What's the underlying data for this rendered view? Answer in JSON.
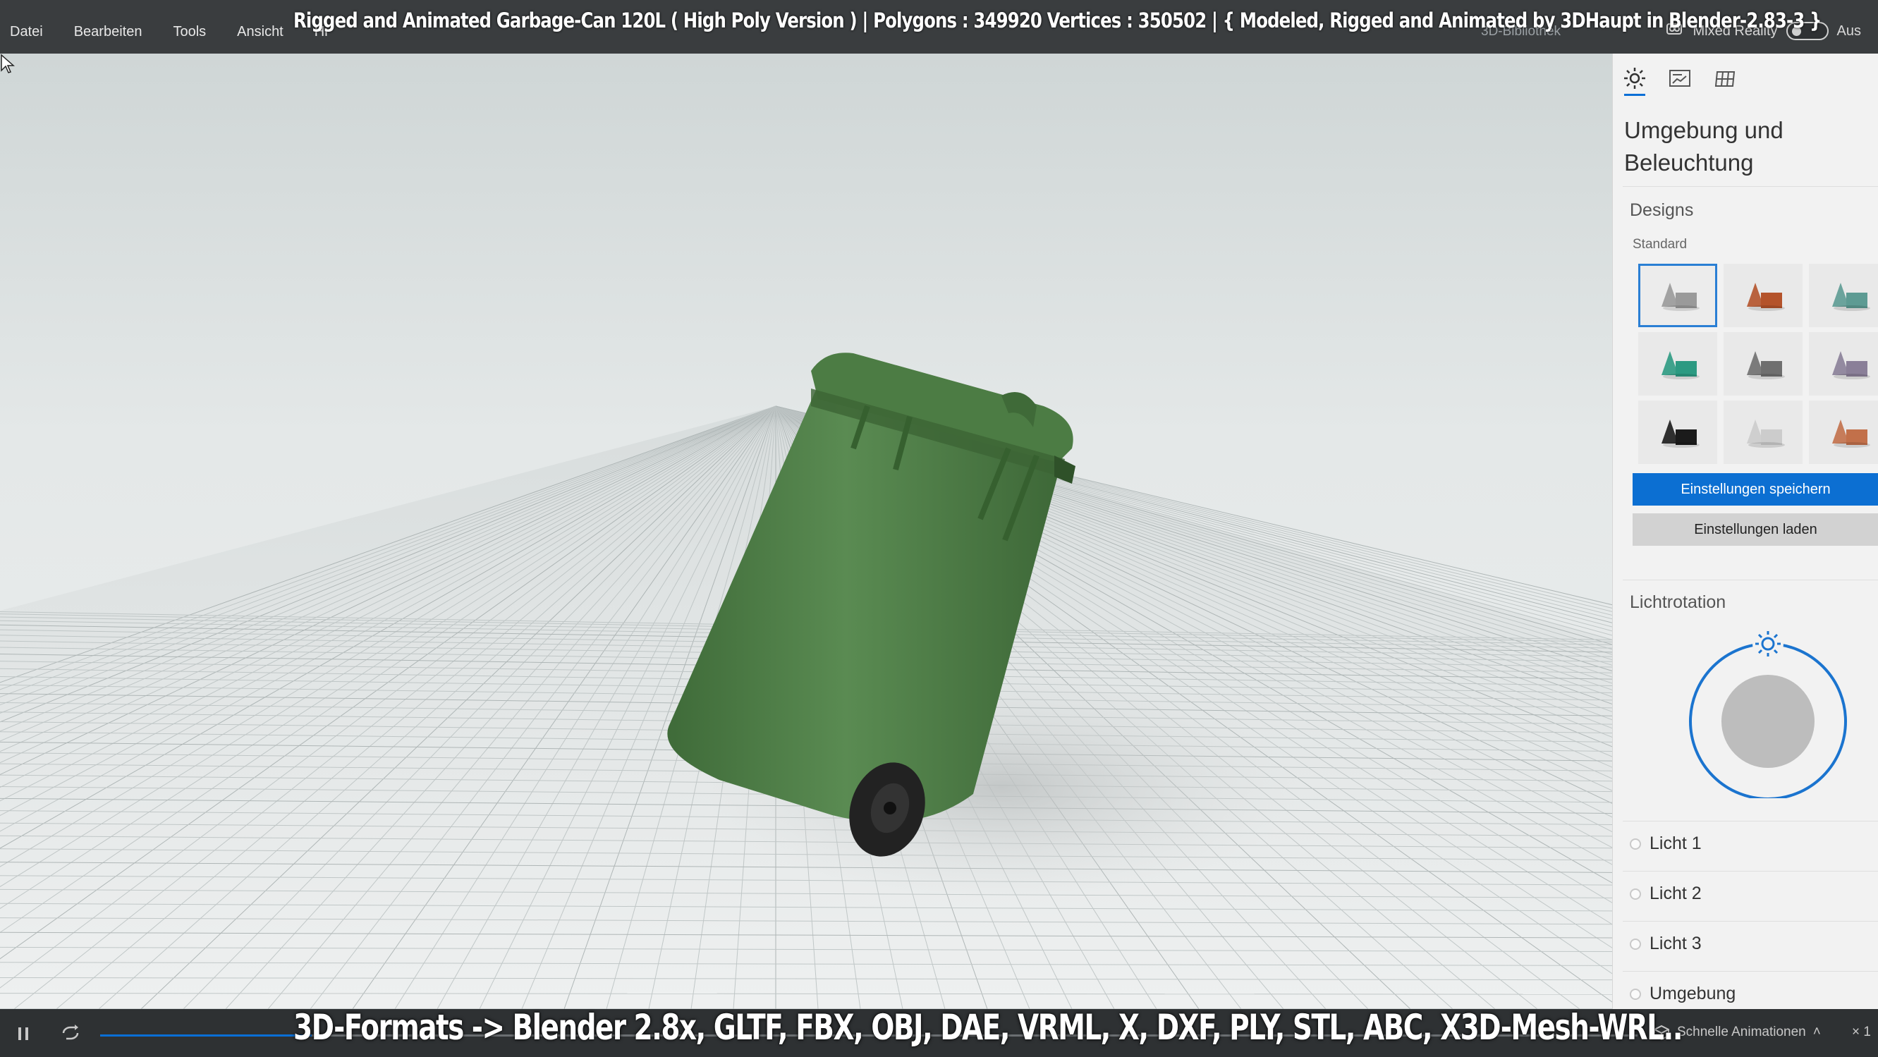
{
  "menu": {
    "items": [
      "Datei",
      "Bearbeiten",
      "Tools",
      "Ansicht",
      "Hi"
    ]
  },
  "video_title": "Rigged and Animated Garbage-Can 120L ( High Poly Version )  |  Polygons : 349920  Vertices : 350502   |   { Modeled, Rigged and Animated by 3DHaupt in Blender-2.83-3 }",
  "header_right": {
    "library_label": "3D-Bibliothek",
    "mixed_reality_label": "Mixed Reality",
    "mixed_reality_state": "Aus"
  },
  "panel": {
    "tabs": [
      "sun-icon",
      "stats-icon",
      "grid-icon"
    ],
    "title": "Umgebung und Beleuchtung",
    "designs_heading": "Designs",
    "designs_sub": "Standard",
    "design_colors": [
      "#9a9a9a",
      "#b4532b",
      "#5d9b93",
      "#2c9a82",
      "#6f6f6f",
      "#8a7f98",
      "#1b1b1b",
      "#cccccc",
      "#c2704a"
    ],
    "save_button": "Einstellungen speichern",
    "load_button": "Einstellungen laden",
    "light_rotation_heading": "Lichtrotation",
    "lights": [
      "Licht 1",
      "Licht 2",
      "Licht 3",
      "Umgebung"
    ]
  },
  "bottom": {
    "fast_animations": "Schnelle Animationen",
    "speed": "× 1"
  },
  "formats_caption": "3D-Formats -> Blender 2.8x, GLTF, FBX, OBJ, DAE, VRML, X, DXF, PLY, STL, ABC, X3D-Mesh-WRL..",
  "colors": {
    "accent": "#0c6fd2",
    "bin_green": "#4f7f47",
    "wheel": "#222222"
  }
}
